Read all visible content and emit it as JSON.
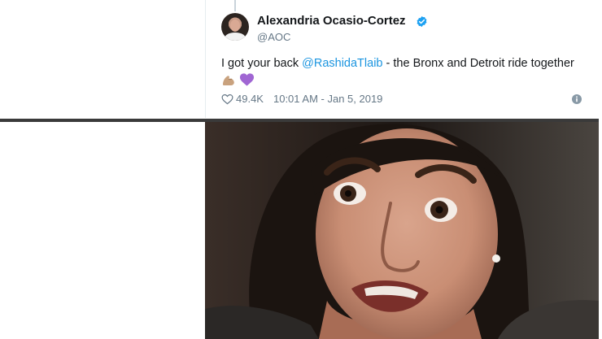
{
  "tweet": {
    "display_name": "Alexandria Ocasio-Cortez",
    "handle": "@AOC",
    "text_before": "I got your back ",
    "mention": "@RashidaTlaib",
    "text_after": " - the Bronx and Detroit ride together ",
    "emojis": [
      "flexed-biceps-emoji",
      "purple-heart-emoji"
    ],
    "likes": "49.4K",
    "timestamp": "10:01 AM - Jan 5, 2019",
    "icons": {
      "verified": "verified-badge-icon",
      "like": "heart-outline-icon",
      "info": "info-icon"
    },
    "colors": {
      "verified": "#1da1f2",
      "mention": "#1b95e0",
      "meta": "#657786",
      "purple_heart": "#a066d3"
    }
  },
  "photo": {
    "subject": "close-up-face-photo"
  }
}
